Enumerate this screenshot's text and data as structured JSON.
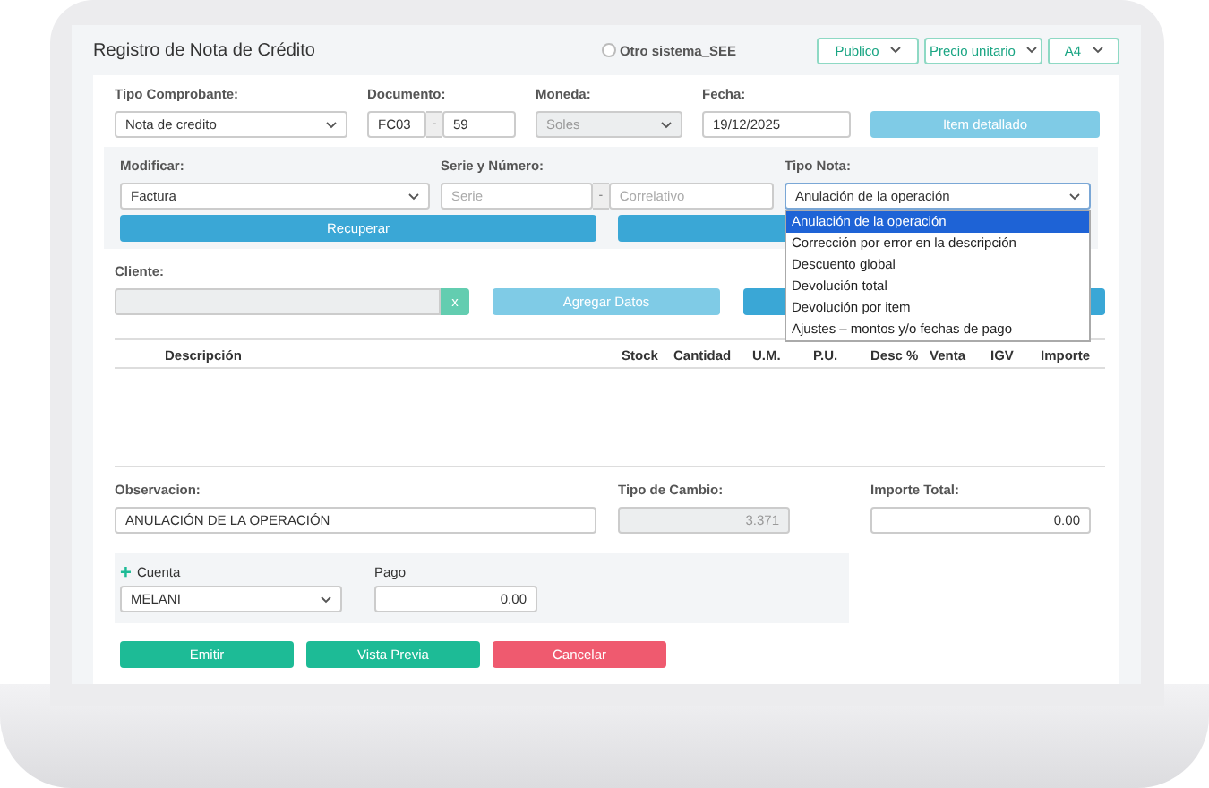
{
  "header": {
    "title": "Registro de Nota de Crédito",
    "other_system": {
      "label": "Otro sistema_SEE",
      "checked": false
    },
    "selects": [
      {
        "value": "Publico"
      },
      {
        "value": "Precio unitario"
      },
      {
        "value": "A4"
      }
    ]
  },
  "row1": {
    "tipo_comprobante": {
      "label": "Tipo Comprobante:",
      "value": "Nota de credito"
    },
    "documento": {
      "label": "Documento:",
      "serie": "FC03",
      "separator": "-",
      "numero": "59"
    },
    "moneda": {
      "label": "Moneda:",
      "value": "Soles",
      "disabled": true
    },
    "fecha": {
      "label": "Fecha:",
      "value": "19/12/2025"
    },
    "item_button": {
      "label": "Item detallado"
    }
  },
  "modify": {
    "modificar": {
      "label": "Modificar:",
      "value": "Factura"
    },
    "serie_numero": {
      "label": "Serie y Número:",
      "serie_placeholder": "Serie",
      "separator": "-",
      "correlativo_placeholder": "Correlativo"
    },
    "tipo_nota": {
      "label": "Tipo Nota:",
      "value": "Anulación de la operación",
      "expanded": true,
      "options": [
        {
          "label": "Anulación de la operación",
          "selected": true
        },
        {
          "label": "Corrección por error en la descripción",
          "selected": false
        },
        {
          "label": "Descuento global",
          "selected": false
        },
        {
          "label": "Devolución total",
          "selected": false
        },
        {
          "label": "Devolución por item",
          "selected": false
        },
        {
          "label": "Ajustes – montos y/o fechas de pago",
          "selected": false
        }
      ]
    },
    "recover_button": {
      "label": "Recuperar"
    }
  },
  "cliente": {
    "label": "Cliente:",
    "clear": "x",
    "add_button": {
      "label": "Agregar Datos"
    }
  },
  "table": {
    "columns": [
      "Descripción",
      "Stock",
      "Cantidad",
      "U.M.",
      "P.U.",
      "Desc %",
      "Venta",
      "IGV",
      "Importe"
    ]
  },
  "footer": {
    "observacion": {
      "label": "Observacion:",
      "value": "ANULACIÓN DE LA OPERACIÓN"
    },
    "tipo_cambio": {
      "label": "Tipo de Cambio:",
      "value": "3.371",
      "disabled": true
    },
    "importe_total": {
      "label": "Importe Total:",
      "value": "0.00"
    }
  },
  "payment": {
    "add": "+",
    "cuenta": {
      "label": "Cuenta",
      "value": "MELANI"
    },
    "pago": {
      "label": "Pago",
      "value": "0.00"
    }
  },
  "actions": [
    {
      "label": "Emitir"
    },
    {
      "label": "Vista Previa"
    },
    {
      "label": "Cancelar"
    }
  ]
}
